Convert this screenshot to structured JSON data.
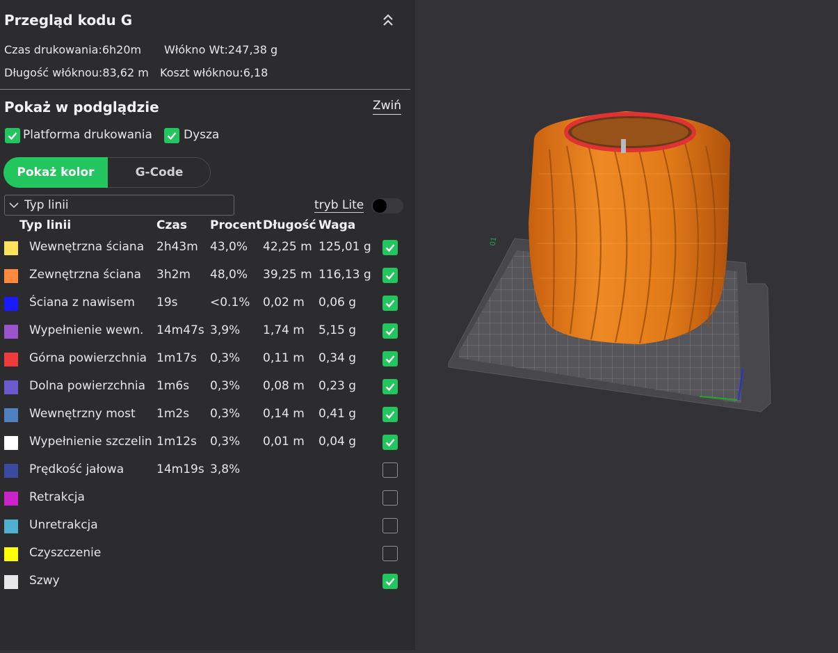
{
  "panel": {
    "title": "Przegląd kodu G",
    "stats": {
      "print_time": "Czas drukowania:6h20m",
      "filament_weight": "Włókno Wt:247,38 g",
      "filament_length": "Długość włóknou:83,62 m",
      "filament_cost": "Koszt włóknou:6,18"
    }
  },
  "preview": {
    "title": "Pokaż w podglądzie",
    "collapse_label": "Zwiń",
    "options": [
      {
        "label": "Platforma drukowania",
        "checked": true
      },
      {
        "label": "Dysza",
        "checked": true
      }
    ],
    "view_toggle": {
      "active": "Pokaż kolor",
      "inactive": "G-Code"
    },
    "dropdown_value": "Typ linii",
    "lite_mode_label": "tryb Lite",
    "lite_mode_on": false
  },
  "table": {
    "headers": [
      "Typ linii",
      "Czas",
      "Procent",
      "Długość",
      "Waga"
    ],
    "rows": [
      {
        "color": "#ffe15a",
        "name": "Wewnętrzna ściana",
        "time": "2h43m",
        "percent": "43,0%",
        "length": "42,25 m",
        "weight": "125,01 g",
        "checked": true
      },
      {
        "color": "#ff8a3c",
        "name": "Zewnętrzna ściana",
        "time": "3h2m",
        "percent": "48,0%",
        "length": "39,25 m",
        "weight": "116,13 g",
        "checked": true
      },
      {
        "color": "#1a1aff",
        "name": "Ściana z nawisem",
        "time": "19s",
        "percent": "<0.1%",
        "length": "0,02 m",
        "weight": "0,06 g",
        "checked": true
      },
      {
        "color": "#9a55cc",
        "name": "Wypełnienie wewn.",
        "time": "14m47s",
        "percent": "3,9%",
        "length": "1,74 m",
        "weight": "5,15 g",
        "checked": true
      },
      {
        "color": "#ee3c3c",
        "name": "Górna powierzchnia",
        "time": "1m17s",
        "percent": "0,3%",
        "length": "0,11 m",
        "weight": "0,34 g",
        "checked": true
      },
      {
        "color": "#6a5acd",
        "name": "Dolna powierzchnia",
        "time": "1m6s",
        "percent": "0,3%",
        "length": "0,08 m",
        "weight": "0,23 g",
        "checked": true
      },
      {
        "color": "#4f80c0",
        "name": "Wewnętrzny most",
        "time": "1m2s",
        "percent": "0,3%",
        "length": "0,14 m",
        "weight": "0,41 g",
        "checked": true
      },
      {
        "color": "#ffffff",
        "name": "Wypełnienie szczelin",
        "time": "1m12s",
        "percent": "0,3%",
        "length": "0,01 m",
        "weight": "0,04 g",
        "checked": true
      },
      {
        "color": "#3a4aa0",
        "name": "Prędkość jałowa",
        "time": "14m19s",
        "percent": "3,8%",
        "length": "",
        "weight": "",
        "checked": false
      },
      {
        "color": "#cc22cc",
        "name": "Retrakcja",
        "time": "",
        "percent": "",
        "length": "",
        "weight": "",
        "checked": false
      },
      {
        "color": "#4fb0d0",
        "name": "Unretrakcja",
        "time": "",
        "percent": "",
        "length": "",
        "weight": "",
        "checked": false
      },
      {
        "color": "#ffff00",
        "name": "Czyszczenie",
        "time": "",
        "percent": "",
        "length": "",
        "weight": "",
        "checked": false
      },
      {
        "color": "#e8e8e8",
        "name": "Szwy",
        "time": "",
        "percent": "",
        "length": "",
        "weight": "",
        "checked": true
      }
    ]
  },
  "colors": {
    "accent": "#22c55e",
    "model": "#e8801e",
    "model_top": "#d03030",
    "bed": "#4a4a4e",
    "panel_bg": "#2c2c2f",
    "viewport_bg": "#333337"
  }
}
